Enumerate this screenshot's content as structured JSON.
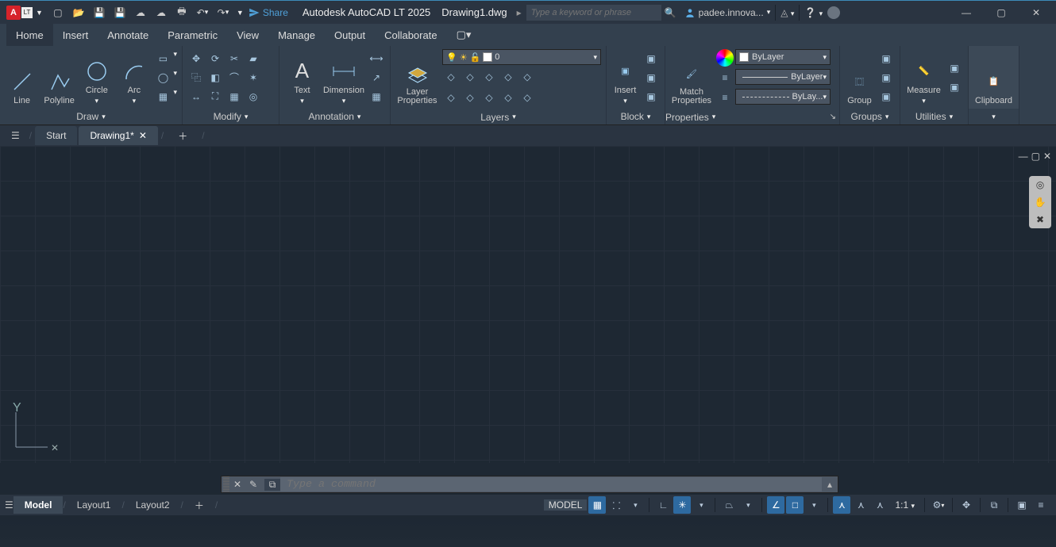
{
  "titlebar": {
    "badge": "A",
    "lt": "LT",
    "share": "Share",
    "app": "Autodesk AutoCAD LT 2025",
    "doc": "Drawing1.dwg",
    "search_ph": "Type a keyword or phrase",
    "user": "padee.innova..."
  },
  "menu": {
    "home": "Home",
    "insert": "Insert",
    "annotate": "Annotate",
    "parametric": "Parametric",
    "view": "View",
    "manage": "Manage",
    "output": "Output",
    "collaborate": "Collaborate"
  },
  "ribbon": {
    "draw": {
      "title": "Draw",
      "line": "Line",
      "polyline": "Polyline",
      "circle": "Circle",
      "arc": "Arc"
    },
    "modify": {
      "title": "Modify"
    },
    "annotation": {
      "title": "Annotation",
      "text": "Text",
      "dimension": "Dimension"
    },
    "layers": {
      "title": "Layers",
      "layerprops": "Layer\nProperties",
      "layer_current": "0"
    },
    "block": {
      "title": "Block",
      "insert": "Insert"
    },
    "properties": {
      "title": "Properties",
      "match": "Match\nProperties",
      "bylayer": "ByLayer",
      "bylayer2": "ByLayer",
      "bylayer3": "ByLay..."
    },
    "groups": {
      "title": "Groups",
      "group": "Group"
    },
    "utilities": {
      "title": "Utilities",
      "measure": "Measure"
    },
    "clipboard": {
      "title": "",
      "clipboard": "Clipboard"
    }
  },
  "filetabs": {
    "start": "Start",
    "current": "Drawing1*"
  },
  "command": {
    "placeholder": "Type a command"
  },
  "layouttabs": {
    "model": "Model",
    "l1": "Layout1",
    "l2": "Layout2"
  },
  "status": {
    "model": "MODEL",
    "scale": "1:1"
  },
  "ucs": {
    "y": "Y"
  }
}
